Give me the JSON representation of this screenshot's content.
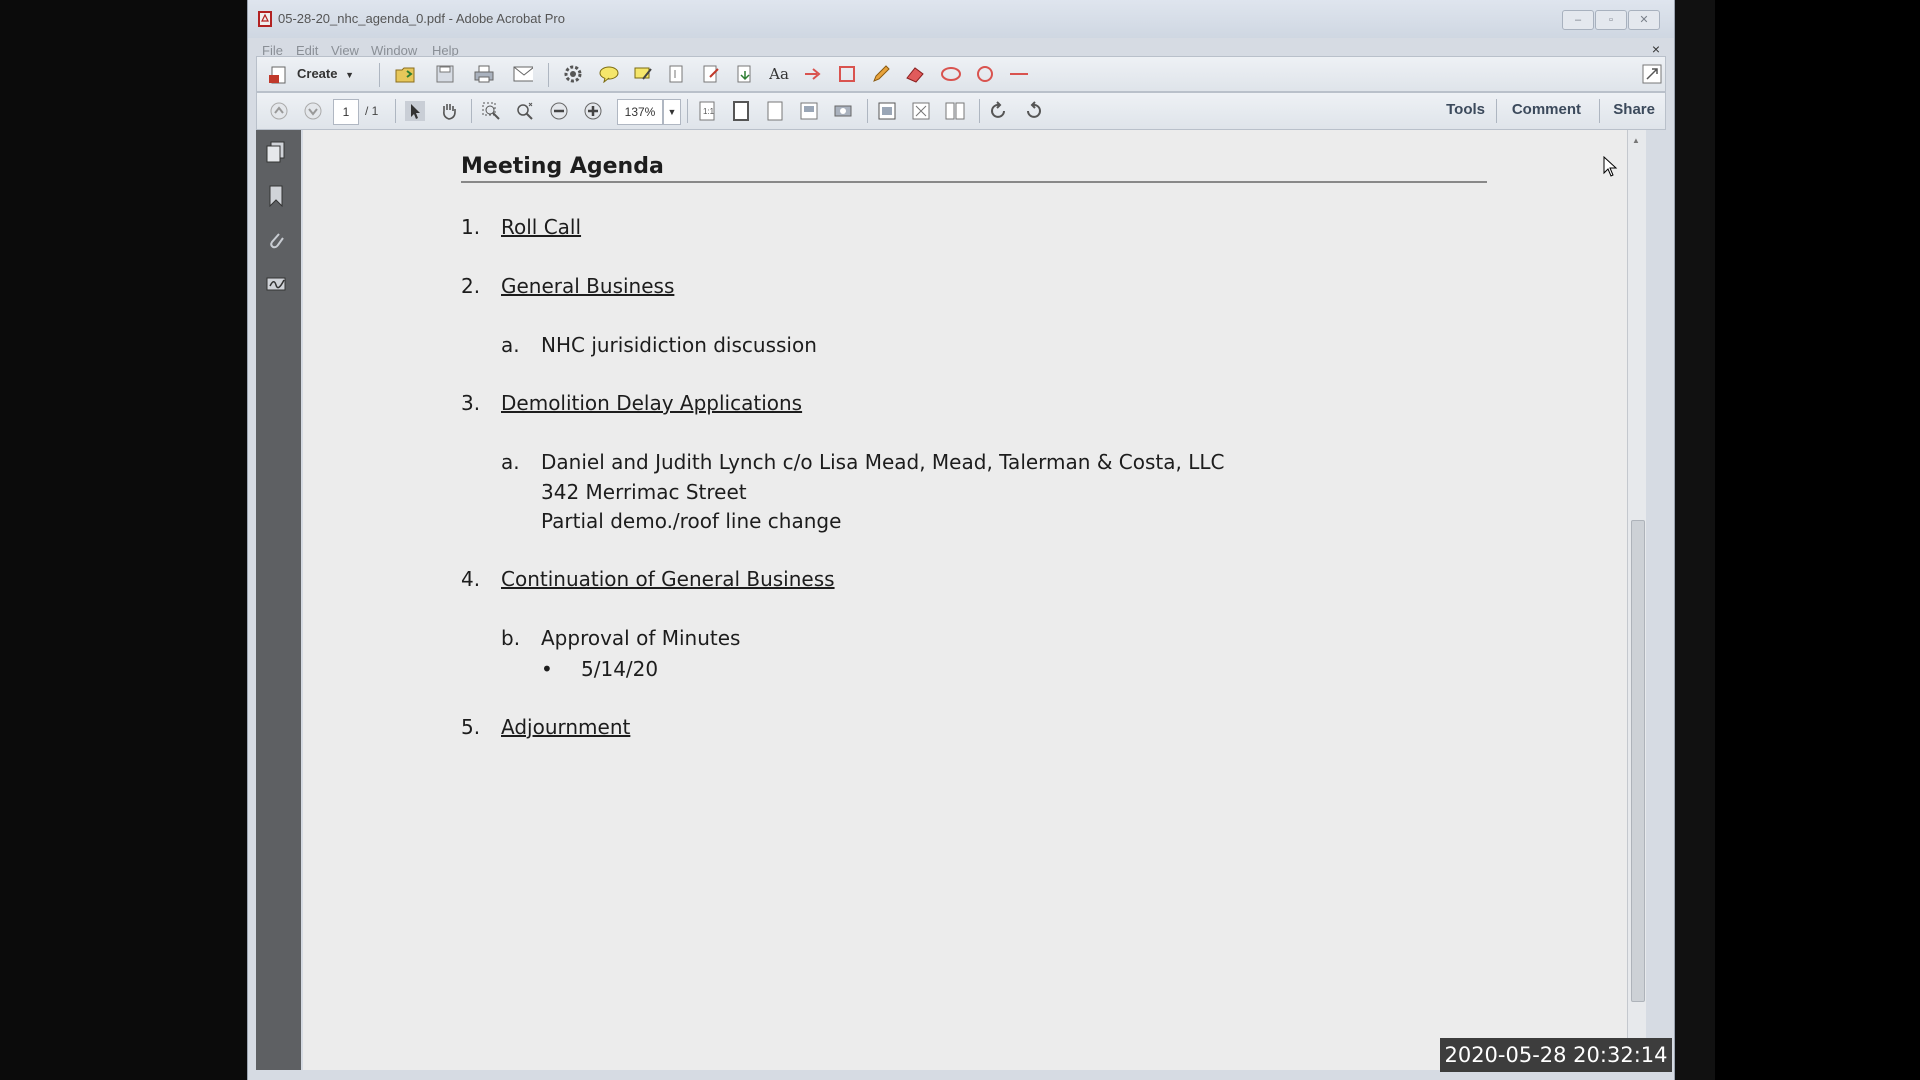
{
  "window": {
    "title": "05-28-20_nhc_agenda_0.pdf - Adobe Acrobat Pro",
    "controls": {
      "minimize": "–",
      "maximize": "▫",
      "close": "✕"
    }
  },
  "menu": {
    "items": [
      "File",
      "Edit",
      "View",
      "Window",
      "Help"
    ],
    "close_doc": "×"
  },
  "toolbar": {
    "create_label": "Create",
    "page_current": "1",
    "page_total": "/ 1",
    "zoom": "137%",
    "tasks": {
      "tools": "Tools",
      "comment": "Comment",
      "share": "Share"
    }
  },
  "document": {
    "heading": "Meeting Agenda",
    "items": [
      {
        "num": "1.",
        "label": "Roll Call"
      },
      {
        "num": "2.",
        "label": "General Business"
      },
      {
        "num": "a.",
        "label": "NHC jurisidiction discussion"
      },
      {
        "num": "3.",
        "label": "Demolition Delay Applications"
      },
      {
        "num": "a.",
        "line1": "Daniel and Judith Lynch c/o Lisa Mead, Mead, Talerman & Costa, LLC",
        "line2": "342 Merrimac Street",
        "line3": "Partial demo./roof line change"
      },
      {
        "num": "4.",
        "label": "Continuation of General Business"
      },
      {
        "num": "b.",
        "label": "Approval of Minutes"
      },
      {
        "bullet": "•",
        "label": "5/14/20"
      },
      {
        "num": "5.",
        "label": "Adjournment"
      }
    ]
  },
  "overlay": {
    "timestamp": "2020-05-28  20:32:14"
  }
}
